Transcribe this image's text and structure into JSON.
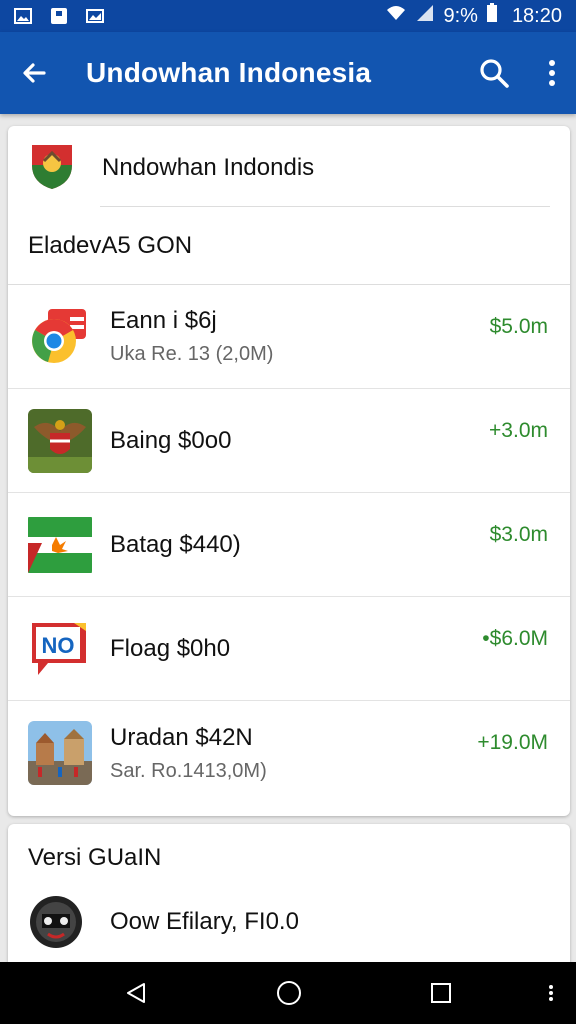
{
  "status_bar": {
    "signal_text": "9:%",
    "time": "18:20",
    "icons": [
      "image-icon",
      "save-icon",
      "gallery-icon",
      "wifi-icon",
      "signal-icon",
      "battery-icon"
    ]
  },
  "app_bar": {
    "title": "Undowhan Indonesia",
    "icons": [
      "back-arrow-icon",
      "search-icon",
      "more-vert-icon"
    ]
  },
  "header": {
    "label": "Nndowhan Indondis",
    "icon": "garuda-shield-icon"
  },
  "section1": {
    "title": "EladevA5 GON",
    "items": [
      {
        "name": "Eann i $6j",
        "sub": "Uka Re. 13 (2,0M)",
        "value": "$5.0m",
        "icon": "chrome-logo-icon"
      },
      {
        "name": "Baing $0o0",
        "sub": "",
        "value": "+3.0m",
        "icon": "garuda-emblem-icon"
      },
      {
        "name": "Batag $440)",
        "sub": "",
        "value": "$3.0m",
        "icon": "leaf-flag-icon"
      },
      {
        "name": "Floag $0h0",
        "sub": "",
        "value": "•$6.0M",
        "icon": "no-badge-icon"
      },
      {
        "name": "Uradan $42N",
        "sub": "Sar. Ro.1413,0M)",
        "value": "+19.0M",
        "icon": "monument-photo-icon"
      }
    ]
  },
  "section2": {
    "title": "Versi GUaIN",
    "item": {
      "name": "Oow Efilary, FI0.0",
      "icon": "tribal-round-icon"
    }
  },
  "nav_bar": {
    "icons": [
      "back-triangle-icon",
      "home-circle-icon",
      "recents-square-icon",
      "nav-more-icon"
    ]
  },
  "colors": {
    "status_bar": "#0d47a1",
    "app_bar": "#1255b0",
    "value_green": "#2e8b2e",
    "background": "#e9e9e9"
  }
}
